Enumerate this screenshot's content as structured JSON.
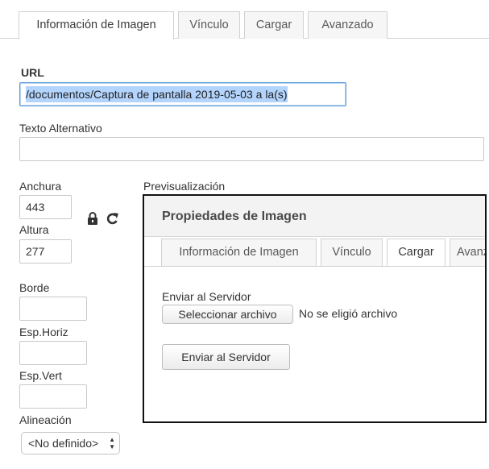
{
  "tabs": [
    {
      "label": "Información de Imagen",
      "active": true
    },
    {
      "label": "Vínculo",
      "active": false
    },
    {
      "label": "Cargar",
      "active": false
    },
    {
      "label": "Avanzado",
      "active": false
    }
  ],
  "url": {
    "label": "URL",
    "value": "/documentos/Captura de pantalla 2019-05-03 a la(s)"
  },
  "alt_text": {
    "label": "Texto Alternativo",
    "value": ""
  },
  "width": {
    "label": "Anchura",
    "value": "443"
  },
  "height": {
    "label": "Altura",
    "value": "277"
  },
  "border": {
    "label": "Borde",
    "value": ""
  },
  "hspace": {
    "label": "Esp.Horiz",
    "value": ""
  },
  "vspace": {
    "label": "Esp.Vert",
    "value": ""
  },
  "align": {
    "label": "Alineación",
    "value": "<No definido>"
  },
  "icons": {
    "lock": "lock-icon",
    "reset": "reset-size-icon"
  },
  "preview": {
    "label": "Previsualización",
    "dialog_title": "Propiedades de Imagen",
    "tabs": [
      {
        "label": "Información de Imagen",
        "active": false
      },
      {
        "label": "Vínculo",
        "active": false
      },
      {
        "label": "Cargar",
        "active": true
      },
      {
        "label": "Avanzado",
        "active": false
      }
    ],
    "send_label": "Enviar al Servidor",
    "choose_file_button": "Seleccionar archivo",
    "no_file_text": "No se eligió archivo",
    "send_button": "Enviar al Servidor"
  }
}
